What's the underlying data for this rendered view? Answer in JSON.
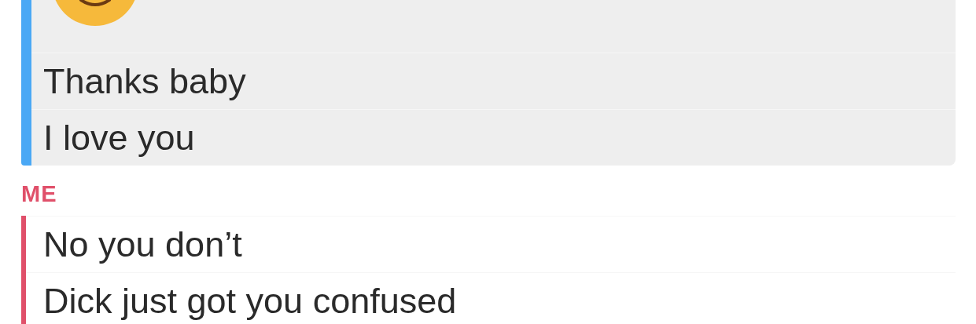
{
  "groups": [
    {
      "color": "#4aa8f5",
      "saved": true,
      "messages": [
        {
          "kind": "emoji"
        },
        {
          "kind": "text",
          "text": "Thanks baby"
        },
        {
          "kind": "text",
          "text": "I love you"
        }
      ]
    },
    {
      "sender": "ME",
      "color": "#e0506a",
      "saved": false,
      "messages": [
        {
          "kind": "text",
          "text": "No you don’t"
        },
        {
          "kind": "text",
          "text": "Dick just got you confused"
        }
      ]
    }
  ]
}
